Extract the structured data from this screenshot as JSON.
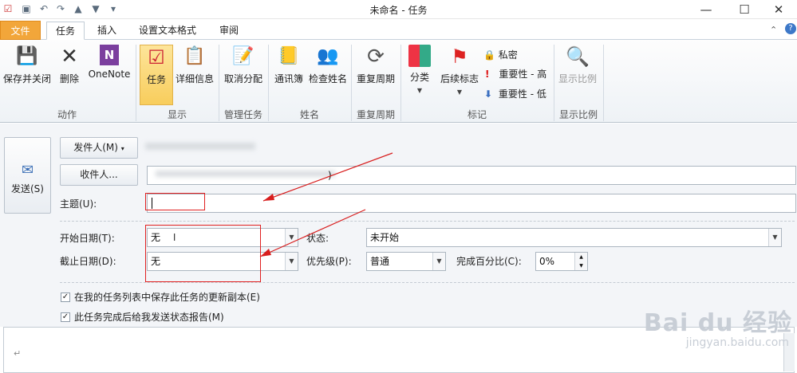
{
  "window": {
    "title": "未命名 - 任务",
    "min_glyph": "—",
    "max_glyph": "☐",
    "close_glyph": "✕"
  },
  "tabs": {
    "file": "文件",
    "task": "任务",
    "insert": "插入",
    "format": "设置文本格式",
    "review": "审阅"
  },
  "ribbon": {
    "save_close": "保存并关闭",
    "delete": "删除",
    "onenote": "OneNote",
    "task": "任务",
    "details": "详细信息",
    "cancel_assign": "取消分配",
    "address_book": "通讯簿",
    "check_names": "检查姓名",
    "recurrence": "重复周期",
    "categorize": "分类",
    "followup": "后续标志",
    "private": "私密",
    "importance_high": "重要性 - 高",
    "importance_low": "重要性 - 低",
    "zoom": "显示比例",
    "groups": {
      "actions": "动作",
      "show": "显示",
      "manage": "管理任务",
      "names": "姓名",
      "recurrence": "重复周期",
      "tags": "标记",
      "zoom": "显示比例"
    }
  },
  "form": {
    "send": "发送(S)",
    "from_button": "发件人(M)",
    "to_button": "收件人...",
    "to_value_suffix": ")",
    "subject_label": "主题(U):",
    "subject_value": "",
    "start_label": "开始日期(T):",
    "start_value": "无",
    "due_label": "截止日期(D):",
    "due_value": "无",
    "status_label": "状态:",
    "status_value": "未开始",
    "priority_label": "优先级(P):",
    "priority_value": "普通",
    "percent_label": "完成百分比(C):",
    "percent_value": "0%",
    "keep_copy": "在我的任务列表中保存此任务的更新副本(E)",
    "send_report": "此任务完成后给我发送状态报告(M)",
    "keep_copy_checked": true,
    "send_report_checked": true,
    "body_mark": "↵"
  },
  "watermark": {
    "brand": "Bai du 经验",
    "url": "jingyan.baidu.com"
  }
}
